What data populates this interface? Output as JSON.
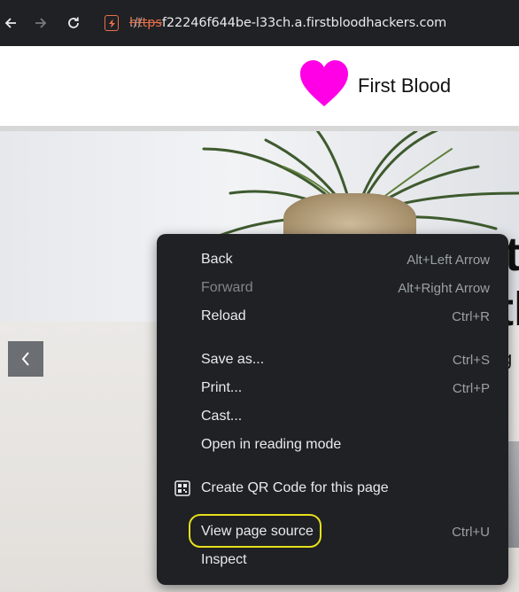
{
  "browser": {
    "url_scheme": "https",
    "url_sep": "://",
    "url_host": "f22246f644be-l33ch.a.firstbloodhackers.com",
    "icons": {
      "back": "arrow-left-icon",
      "forward": "arrow-right-icon",
      "reload": "reload-icon",
      "site_security": "lightning-shield-icon"
    }
  },
  "page": {
    "brand_name": "First Blood",
    "brand_color": "#ff00e6",
    "hero_letters": [
      "t",
      "th",
      "g"
    ]
  },
  "context_menu": {
    "items": [
      {
        "label": "Back",
        "accel": "Alt+Left Arrow",
        "enabled": true
      },
      {
        "label": "Forward",
        "accel": "Alt+Right Arrow",
        "enabled": false
      },
      {
        "label": "Reload",
        "accel": "Ctrl+R",
        "enabled": true
      },
      {
        "label": "Save as...",
        "accel": "Ctrl+S",
        "enabled": true
      },
      {
        "label": "Print...",
        "accel": "Ctrl+P",
        "enabled": true
      },
      {
        "label": "Cast...",
        "accel": "",
        "enabled": true
      },
      {
        "label": "Open in reading mode",
        "accel": "",
        "enabled": true
      },
      {
        "label": "Create QR Code for this page",
        "accel": "",
        "enabled": true,
        "icon": "qr-code-icon"
      },
      {
        "label": "View page source",
        "accel": "Ctrl+U",
        "enabled": true,
        "highlighted": true
      },
      {
        "label": "Inspect",
        "accel": "",
        "enabled": true
      }
    ],
    "highlight_color": "#e6df1c"
  }
}
